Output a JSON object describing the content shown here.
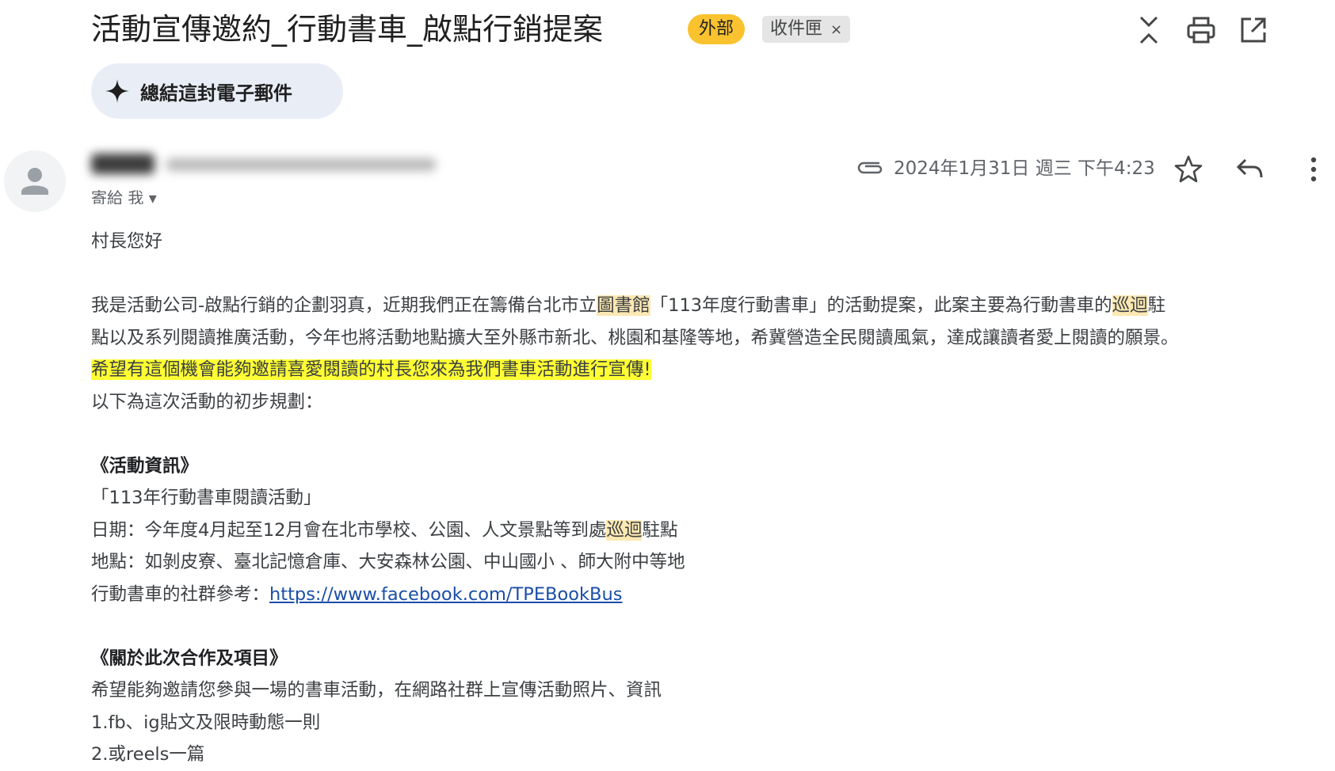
{
  "header": {
    "subject": "活動宣傳邀約_行動書車_啟點行銷提案",
    "external_badge": "外部",
    "label_chip": "收件匣",
    "label_remove": "×"
  },
  "summary_button": {
    "label": "總結這封電子郵件"
  },
  "meta": {
    "to_line": "寄給 我 ▾",
    "date": "2024年1月31日 週三 下午4:23"
  },
  "body": {
    "greeting": "村長您好",
    "p1_a": "我是活動公司-啟點行銷的企劃羽真，近期我們正在籌備台北市立",
    "p1_hl1": "圖書館",
    "p1_b": "「113年度行動書車」的活動提案，此案主要為行動書車的",
    "p1_hl2": "巡迴",
    "p1_c": "駐",
    "p2": "點以及系列閱讀推廣活動，今年也將活動地點擴大至外縣市新北、桃園和基隆等地，希冀營造全民閱讀風氣，達成讓讀者愛上閱讀的願景。",
    "p3": "希望有這個機會能夠邀請喜愛閱讀的村長您來為我們書車活動進行宣傳!",
    "p4": "以下為這次活動的初步規劃：",
    "sec1_title": "《活動資訊》",
    "event_name": "「113年行動書車閱讀活動」",
    "date_a": "日期：今年度4月起至12月會在北市學校、公園、人文景點等到處",
    "date_hl": "巡迴",
    "date_b": "駐點",
    "location": "地點：如剝皮寮、臺北記憶倉庫、大安森林公園、中山國小 、師大附中等地",
    "social_prefix": "行動書車的社群參考：",
    "social_link": "https://www.facebook.com/TPEBookBus",
    "sec2_title": "《關於此次合作及項目》",
    "coop": "希望能夠邀請您參與一場的書車活動，在網路社群上宣傳活動照片、資訊",
    "item1": "1.fb、ig貼文及限時動態一則",
    "item2": "2.或reels一篇"
  },
  "icons": [
    "collapse-icon",
    "print-icon",
    "open-in-new-icon",
    "sparkle-icon",
    "avatar-person-icon",
    "attachment-icon",
    "star-icon",
    "reply-icon",
    "more-vert-icon"
  ],
  "colors": {
    "external_badge": "#f9c22e",
    "highlight": "#fce8b2",
    "highlight_yellow": "#ffff33",
    "link": "#1a4ea8"
  }
}
